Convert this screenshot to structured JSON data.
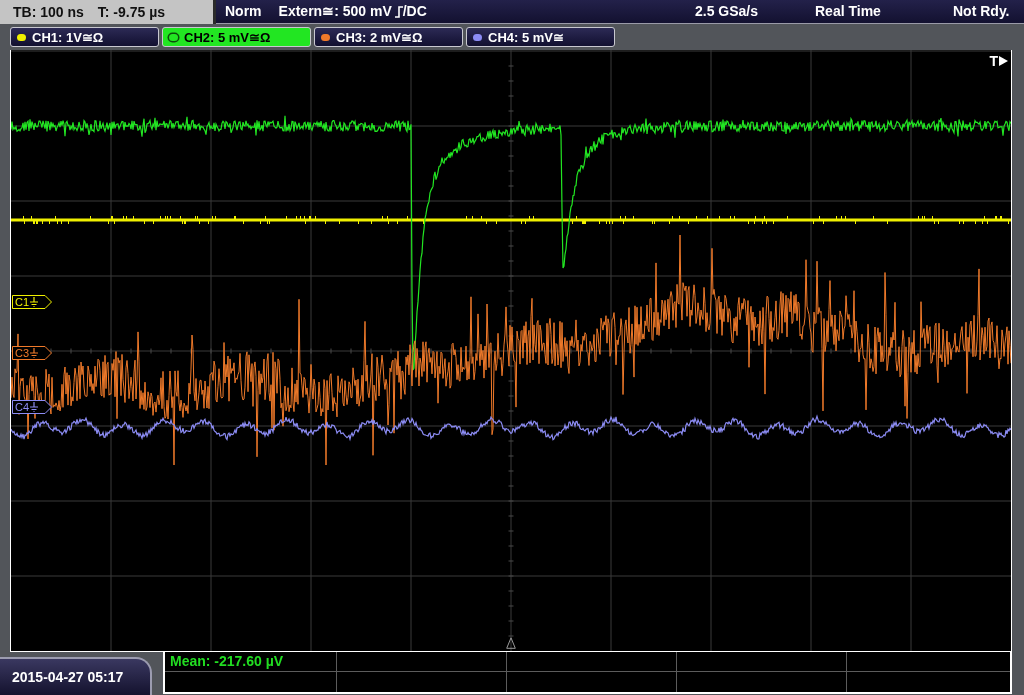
{
  "timebase": {
    "scale": "TB: 100 ns",
    "offset": "T: -9.75 µs"
  },
  "trigger_bar": {
    "mode": "Norm",
    "source": "Extern≅: 500 mV",
    "coupling": "/DC",
    "sample_rate": "2.5 GSa/s",
    "acquisition": "Real Time",
    "state": "Not Rdy."
  },
  "channels": [
    {
      "label": "CH1: 1V≅Ω",
      "color": "#f0f000",
      "selected": false
    },
    {
      "label": "CH2: 5 mV≅Ω",
      "color": "#22e622",
      "selected": true
    },
    {
      "label": "CH3: 2 mV≅Ω",
      "color": "#f07a2a",
      "selected": false
    },
    {
      "label": "CH4: 5 mV≅",
      "color": "#8c8cf4",
      "selected": false
    }
  ],
  "display": {
    "trigger_position": "T",
    "markers": [
      {
        "label": "C1",
        "color": "#f0f000"
      },
      {
        "label": "C3",
        "color": "#f07a2a"
      },
      {
        "label": "C4",
        "color": "#8c8cf4"
      }
    ]
  },
  "datetime": "2015-04-27 05:17",
  "measurements": [
    "Mean: -217.60 µV"
  ]
}
